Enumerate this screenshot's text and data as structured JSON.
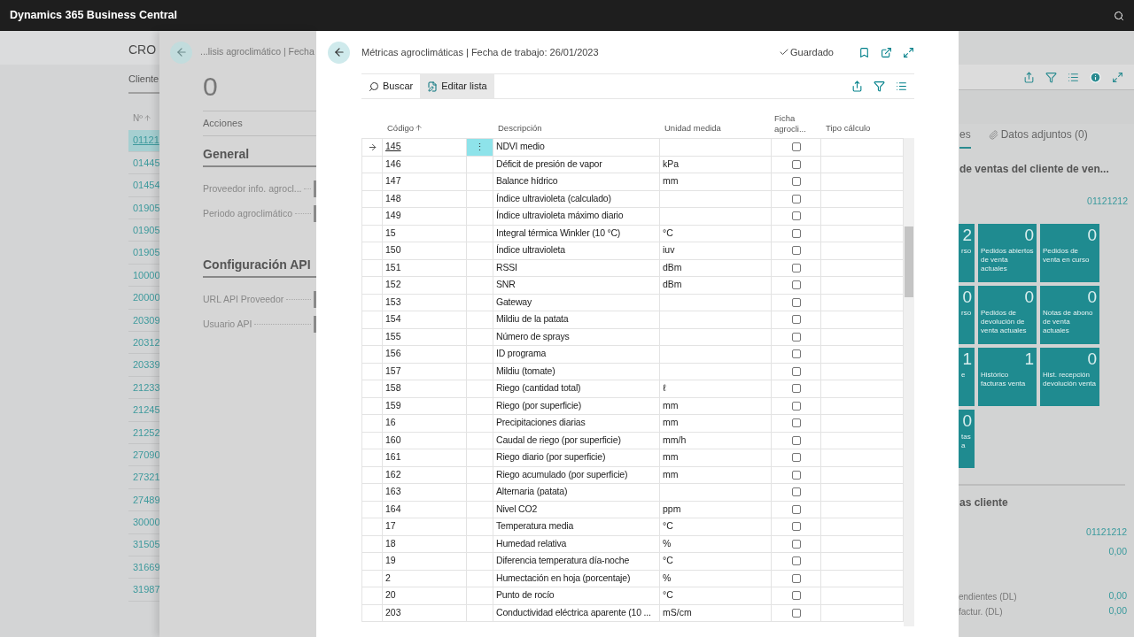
{
  "top_bar": {
    "title": "Dynamics 365 Business Central"
  },
  "background_page": {
    "title": "CRO",
    "tab": "Cliente",
    "column_header": "Nº",
    "customers": [
      {
        "number": "01121",
        "selected": true
      },
      {
        "number": "01445",
        "selected": false
      },
      {
        "number": "01454",
        "selected": false
      },
      {
        "number": "01905",
        "selected": false
      },
      {
        "number": "01905",
        "selected": false
      },
      {
        "number": "01905",
        "selected": false
      },
      {
        "number": "10000",
        "selected": false
      },
      {
        "number": "20000",
        "selected": false
      },
      {
        "number": "20309",
        "selected": false
      },
      {
        "number": "20312",
        "selected": false
      },
      {
        "number": "20339",
        "selected": false
      },
      {
        "number": "21233",
        "selected": false
      },
      {
        "number": "21245",
        "selected": false
      },
      {
        "number": "21252",
        "selected": false
      },
      {
        "number": "27090",
        "selected": false
      },
      {
        "number": "27321",
        "selected": false
      },
      {
        "number": "27489",
        "selected": false
      },
      {
        "number": "30000",
        "selected": false
      },
      {
        "number": "31505",
        "selected": false
      },
      {
        "number": "31669",
        "selected": false
      },
      {
        "number": "31987",
        "selected": false
      }
    ]
  },
  "middle_panel": {
    "breadcrumb": "...lisis agroclimático | Fecha",
    "value": "0",
    "actions_label": "Acciones",
    "sections": [
      {
        "title": "General",
        "fields": [
          "Proveedor info. agrocl...",
          "Periodo agroclimático"
        ]
      },
      {
        "title": "Configuración API",
        "fields": [
          "URL API Proveedor",
          "Usuario API"
        ]
      }
    ]
  },
  "modal": {
    "title": "Métricas agroclimáticas | Fecha de trabajo: 26/01/2023",
    "save_status": "Guardado",
    "row_menu": "⋮",
    "actions": [
      {
        "label": "Buscar",
        "kind": "search",
        "selected": false
      },
      {
        "label": "Editar lista",
        "kind": "edit",
        "selected": true
      }
    ],
    "columns": [
      "Código",
      "Descripción",
      "Unidad medida",
      "Ficha agrocli...",
      "Tipo cálculo"
    ],
    "rows": [
      {
        "code": "145",
        "description": "NDVI medio",
        "ficha": false,
        "selected": true
      },
      {
        "code": "146",
        "description": "Déficit de presión de vapor",
        "unit": "kPa",
        "ficha": false,
        "selected": false
      },
      {
        "code": "147",
        "description": "Balance hídrico",
        "unit": "mm",
        "ficha": false,
        "selected": false
      },
      {
        "code": "148",
        "description": "Índice ultravioleta (calculado)",
        "ficha": false,
        "selected": false
      },
      {
        "code": "149",
        "description": "Índice ultravioleta máximo diario",
        "ficha": false,
        "selected": false
      },
      {
        "code": "15",
        "description": "Integral térmica Winkler (10 °C)",
        "unit": "°C",
        "ficha": false,
        "selected": false
      },
      {
        "code": "150",
        "description": "Índice ultravioleta",
        "unit": "iuv",
        "ficha": false,
        "selected": false
      },
      {
        "code": "151",
        "description": "RSSI",
        "unit": "dBm",
        "ficha": false,
        "selected": false
      },
      {
        "code": "152",
        "description": "SNR",
        "unit": "dBm",
        "ficha": false,
        "selected": false
      },
      {
        "code": "153",
        "description": "Gateway",
        "ficha": false,
        "selected": false
      },
      {
        "code": "154",
        "description": "Mildiu de la patata",
        "ficha": false,
        "selected": false
      },
      {
        "code": "155",
        "description": "Número de sprays",
        "ficha": false,
        "selected": false
      },
      {
        "code": "156",
        "description": "ID programa",
        "ficha": false,
        "selected": false
      },
      {
        "code": "157",
        "description": "Mildiu (tomate)",
        "ficha": false,
        "selected": false
      },
      {
        "code": "158",
        "description": "Riego (cantidad total)",
        "unit": "ℓ",
        "ficha": false,
        "selected": false
      },
      {
        "code": "159",
        "description": "Riego (por superficie)",
        "unit": "mm",
        "ficha": false,
        "selected": false
      },
      {
        "code": "16",
        "description": "Precipitaciones diarias",
        "unit": "mm",
        "ficha": false,
        "selected": false
      },
      {
        "code": "160",
        "description": "Caudal de riego (por superficie)",
        "unit": "mm/h",
        "ficha": false,
        "selected": false
      },
      {
        "code": "161",
        "description": "Riego diario (por superficie)",
        "unit": "mm",
        "ficha": false,
        "selected": false
      },
      {
        "code": "162",
        "description": "Riego acumulado (por superficie)",
        "unit": "mm",
        "ficha": false,
        "selected": false
      },
      {
        "code": "163",
        "description": "Alternaria (patata)",
        "ficha": false,
        "selected": false
      },
      {
        "code": "164",
        "description": "Nivel CO2",
        "unit": "ppm",
        "ficha": false,
        "selected": false
      },
      {
        "code": "17",
        "description": "Temperatura media",
        "unit": "°C",
        "ficha": false,
        "selected": false
      },
      {
        "code": "18",
        "description": "Humedad relativa",
        "unit": "%",
        "ficha": false,
        "selected": false
      },
      {
        "code": "19",
        "description": "Diferencia temperatura día-noche",
        "unit": "°C",
        "ficha": false,
        "selected": false
      },
      {
        "code": "2",
        "description": "Humectación en hoja (porcentaje)",
        "unit": "%",
        "ficha": false,
        "selected": false
      },
      {
        "code": "20",
        "description": "Punto de rocío",
        "unit": "°C",
        "ficha": false,
        "selected": false
      },
      {
        "code": "203",
        "description": "Conductividad eléctrica aparente (10 ...",
        "unit": "mS/cm",
        "ficha": false,
        "selected": false
      }
    ]
  },
  "right_panel": {
    "tabs": [
      {
        "label": "es",
        "selected": true
      },
      {
        "label": "Datos adjuntos (0)",
        "selected": false
      }
    ],
    "heading": "de ventas del cliente de ven...",
    "customer_no": "01121212",
    "tiles": [
      {
        "value": "2",
        "label": "rso"
      },
      {
        "value": "0",
        "label": "Pedidos abiertos de venta actuales"
      },
      {
        "value": "0",
        "label": "Pedidos de venta en curso"
      },
      {
        "value": "0",
        "label": "rso"
      },
      {
        "value": "0",
        "label": "Pedidos de devolución de venta actuales"
      },
      {
        "value": "0",
        "label": "Notas de abono de venta actuales"
      },
      {
        "value": "1",
        "label": "e"
      },
      {
        "value": "1",
        "label": "Histórico facturas venta"
      },
      {
        "value": "0",
        "label": "Hist. recepción devolución venta"
      },
      {
        "value": "0",
        "label": "tas a"
      }
    ],
    "stats_heading": "as cliente",
    "stats": [
      {
        "value": "01121212"
      },
      {
        "value": "0,00"
      },
      {
        "label": "endientes (DL)",
        "value": "0,00"
      },
      {
        "label": "factur. (DL)",
        "value": "0,00"
      }
    ]
  }
}
